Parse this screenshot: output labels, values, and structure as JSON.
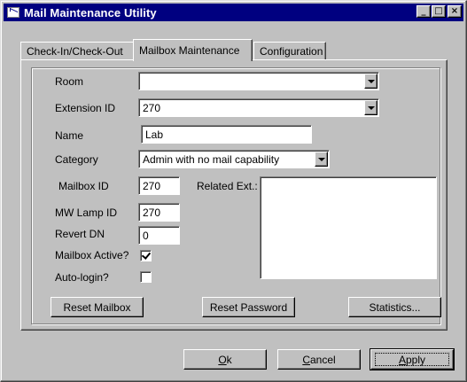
{
  "window": {
    "title": "Mail Maintenance Utility",
    "minimize_glyph": "_",
    "maximize_glyph": "□",
    "close_glyph": "×"
  },
  "tabs": [
    {
      "label": "Check-In/Check-Out",
      "active": false
    },
    {
      "label": "Mailbox Maintenance",
      "active": true
    },
    {
      "label": "Configuration",
      "active": false
    }
  ],
  "form": {
    "room": {
      "label": "Room",
      "value": ""
    },
    "extension_id": {
      "label": "Extension ID",
      "value": "270"
    },
    "name": {
      "label": "Name",
      "value": "Lab"
    },
    "category": {
      "label": "Category",
      "value": "Admin with no mail capability"
    },
    "mailbox_id": {
      "label": "Mailbox ID",
      "value": "270"
    },
    "mw_lamp_id": {
      "label": "MW Lamp ID",
      "value": "270"
    },
    "revert_dn": {
      "label": "Revert DN",
      "value": "0"
    },
    "mailbox_active": {
      "label": "Mailbox Active?",
      "checked": true
    },
    "auto_login": {
      "label": "Auto-login?",
      "checked": false
    },
    "related_ext": {
      "label": "Related Ext.:",
      "items": []
    }
  },
  "actions": {
    "reset_mailbox": "Reset Mailbox",
    "reset_password": "Reset Password",
    "statistics": "Statistics..."
  },
  "dialog_buttons": {
    "ok_mnemonic": "O",
    "ok_rest": "k",
    "cancel_mnemonic": "C",
    "cancel_rest": "ancel",
    "apply_mnemonic": "A",
    "apply_rest": "pply"
  },
  "colors": {
    "face": "#c0c0c0",
    "titlebar": "#000080",
    "field": "#ffffff"
  },
  "icons": [
    "app-window-icon",
    "minimize-icon",
    "maximize-icon",
    "close-icon",
    "dropdown-arrow-icon",
    "checkmark-icon"
  ]
}
